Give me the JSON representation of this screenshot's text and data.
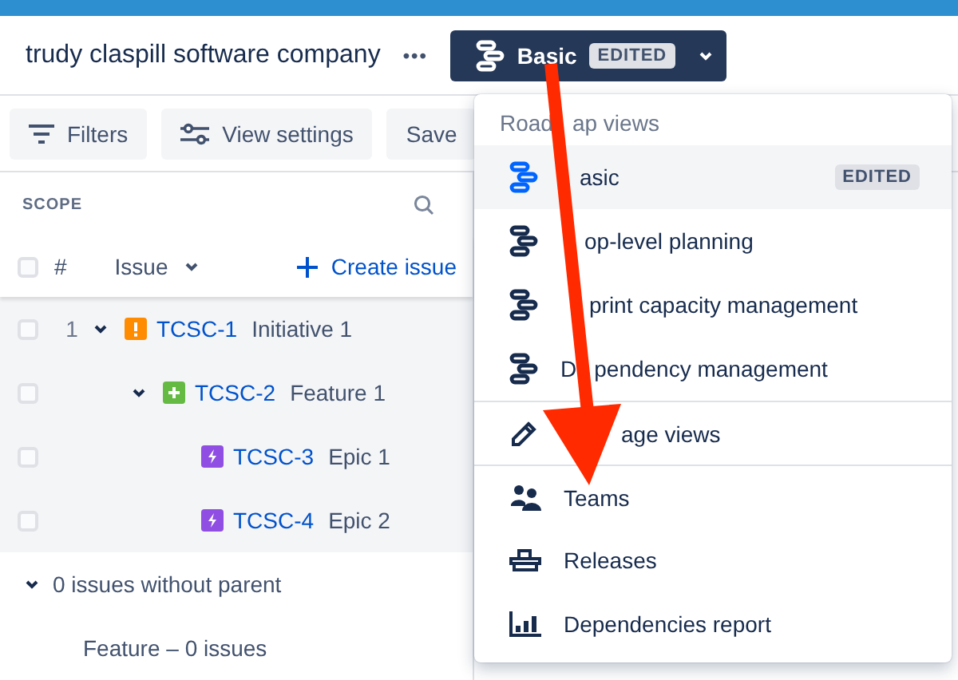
{
  "header": {
    "title": "trudy claspill software company",
    "more": "•••",
    "view_button": {
      "label": "Basic",
      "badge": "EDITED"
    }
  },
  "toolbar": [
    "Filters",
    "View settings",
    "Save"
  ],
  "scope": {
    "title": "SCOPE",
    "columns": {
      "checked": false,
      "number": "#",
      "issue": "Issue",
      "create": "Create issue"
    },
    "rows": [
      {
        "checked": false,
        "number": "1",
        "key": "TCSC-1",
        "summary": "Initiative 1",
        "kind": "initiative",
        "expanded": true,
        "children": [
          {
            "checked": false,
            "key": "TCSC-2",
            "summary": "Feature 1",
            "kind": "feature",
            "expanded": true,
            "children": [
              {
                "checked": false,
                "key": "TCSC-3",
                "summary": "Epic 1",
                "kind": "epic"
              },
              {
                "checked": false,
                "key": "TCSC-4",
                "summary": "Epic 2",
                "kind": "epic"
              }
            ]
          }
        ]
      }
    ],
    "without_parent": {
      "label": "0 issues without parent",
      "expanded": true,
      "groups": [
        "Feature – 0 issues"
      ]
    }
  },
  "menu": {
    "heading": [
      "Road",
      "ap views"
    ],
    "items": [
      {
        "kind": "view",
        "covered_start": true,
        "parts": [
          "asic"
        ],
        "badge": "EDITED",
        "selected": true
      },
      {
        "kind": "view",
        "covered_start": true,
        "parts": [
          "op-level planning"
        ],
        "selected": false
      },
      {
        "kind": "view",
        "covered_start": true,
        "parts": [
          "print capacity management"
        ],
        "selected": false
      },
      {
        "kind": "view",
        "covered_start": false,
        "parts": [
          "D",
          "pendency management"
        ],
        "selected": false
      },
      {
        "kind": "manage",
        "covered_start": true,
        "parts": [
          "age views"
        ]
      },
      {
        "kind": "teams",
        "covered_start": false,
        "parts": [
          "Teams"
        ]
      },
      {
        "kind": "releases",
        "covered_start": false,
        "parts": [
          "Releases"
        ]
      },
      {
        "kind": "report",
        "covered_start": false,
        "parts": [
          "Dependencies report"
        ]
      }
    ]
  },
  "annotation": {
    "kind": "arrow"
  }
}
